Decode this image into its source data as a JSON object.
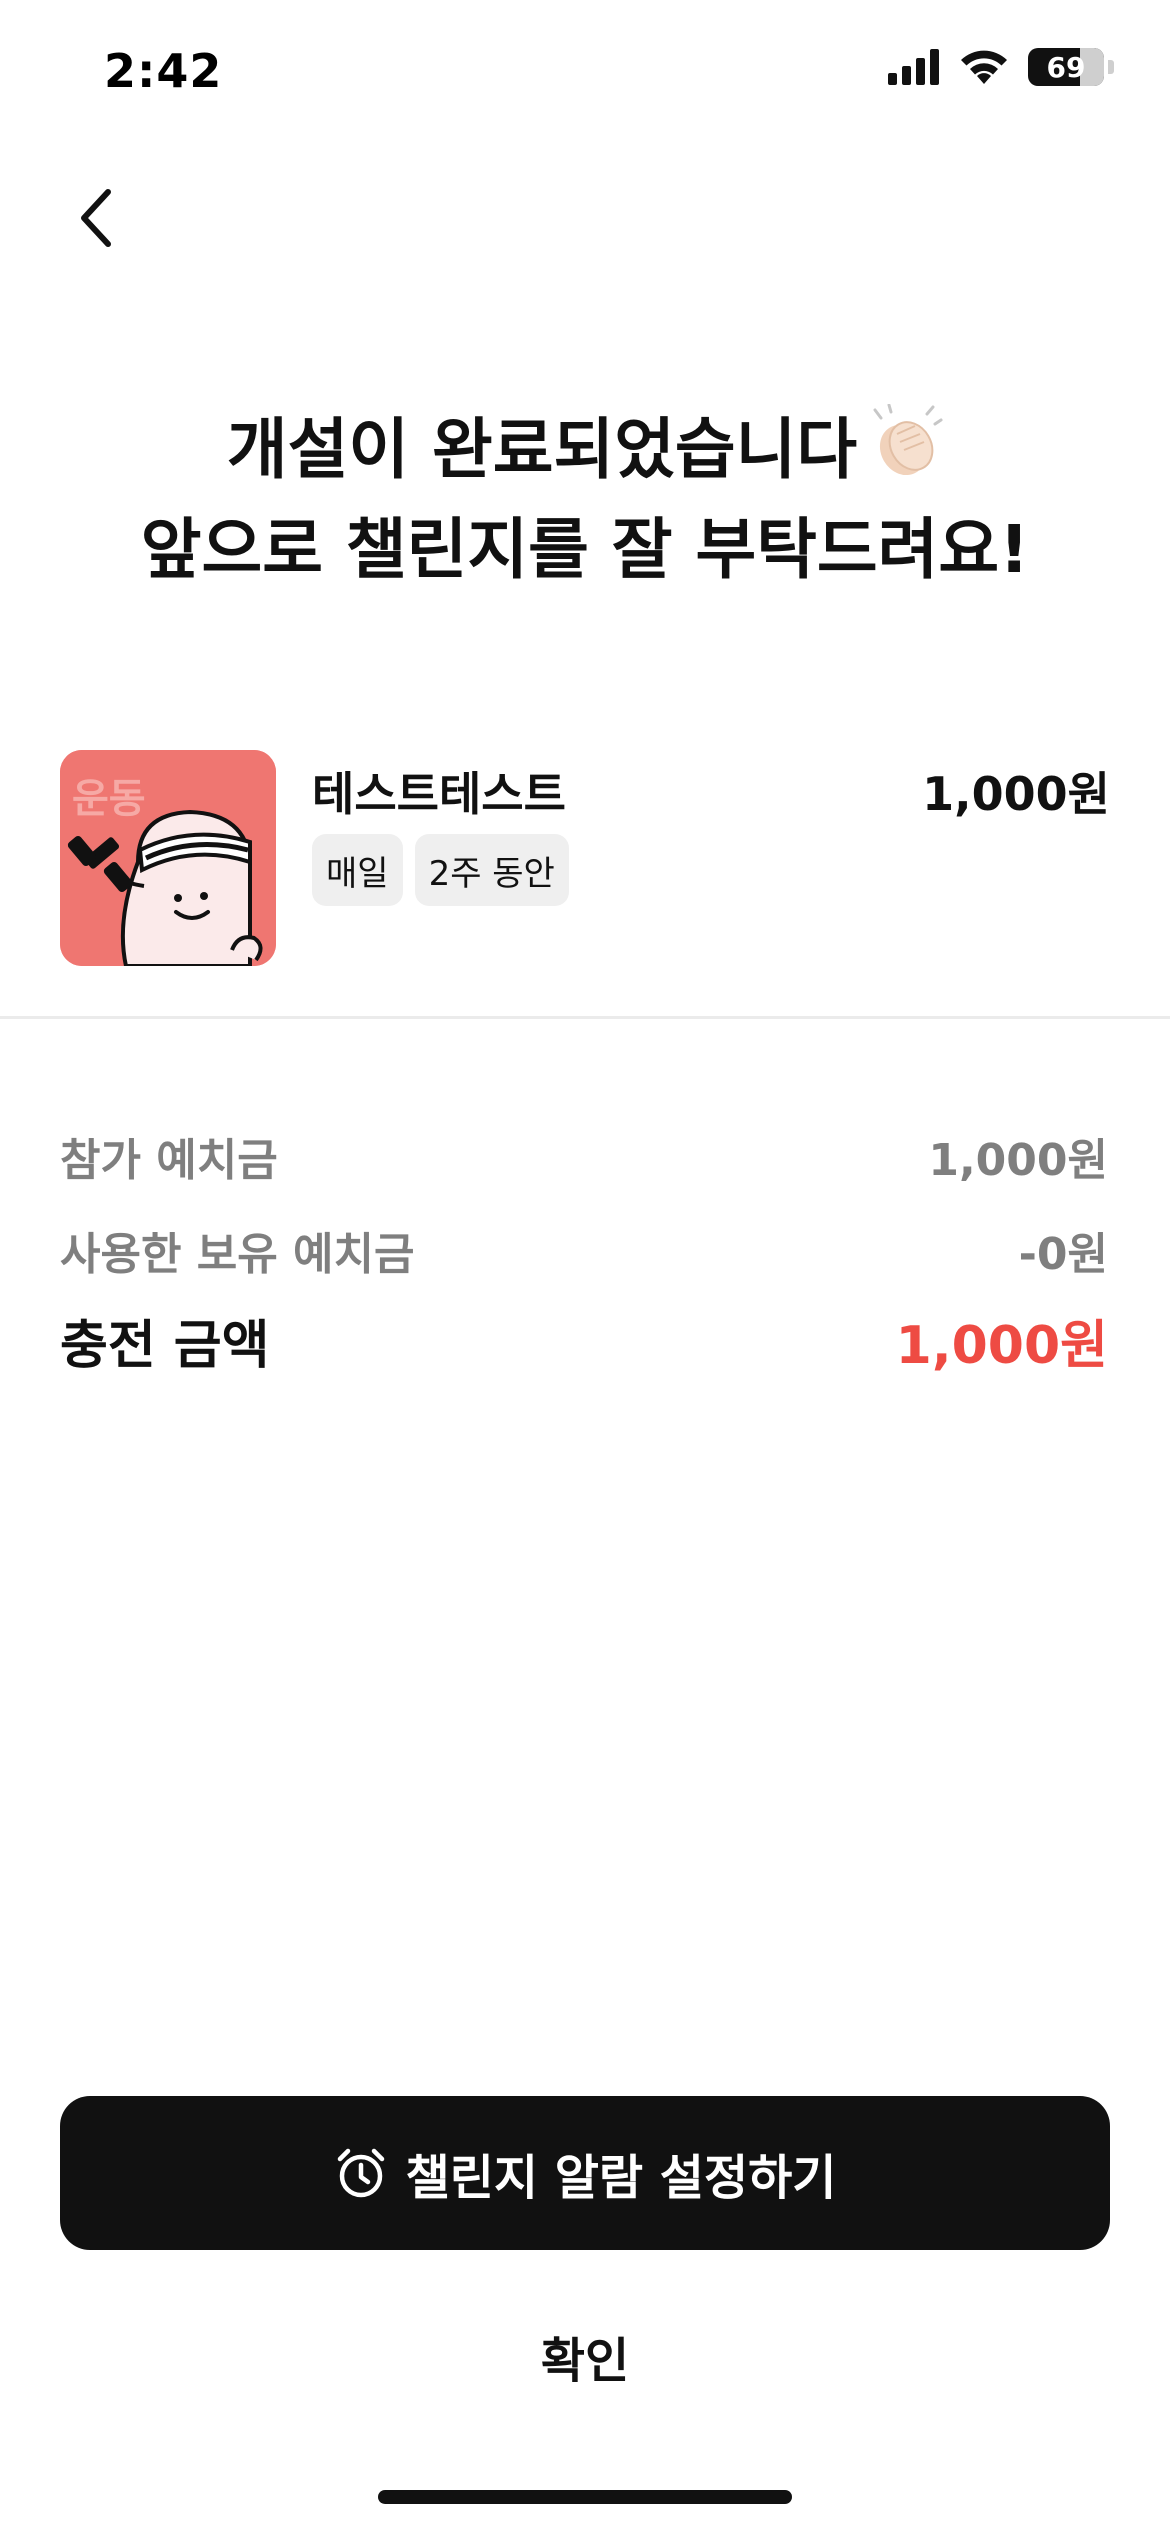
{
  "status_bar": {
    "time": "2:42",
    "battery_level": "69",
    "battery_fraction": 0.69,
    "icons": [
      "signal-icon",
      "wifi-icon",
      "battery-icon"
    ]
  },
  "nav": {
    "back_icon": "chevron-left-icon"
  },
  "headline": {
    "line1": "개설이 완료되었습니다",
    "line2": "앞으로 챌린지를 잘 부탁드려요!",
    "emoji_icon": "clapping-hands-icon"
  },
  "challenge": {
    "thumbnail_label": "운동",
    "name": "테스트테스트",
    "price": "1,000원",
    "tags": [
      "매일",
      "2주 동안"
    ]
  },
  "summary": {
    "deposit_label": "참가 예치금",
    "deposit_value": "1,000원",
    "used_label": "사용한 보유 예치금",
    "used_value": "-0원",
    "charge_label": "충전 금액",
    "charge_value": "1,000원"
  },
  "actions": {
    "alarm_label": "챌린지 알람 설정하기",
    "alarm_icon": "alarm-clock-icon",
    "confirm_label": "확인"
  },
  "colors": {
    "primary_button": "#111111",
    "accent_red": "#ee4b43",
    "thumbnail_bg": "#ef7671",
    "muted_text": "#7f7f7f"
  }
}
